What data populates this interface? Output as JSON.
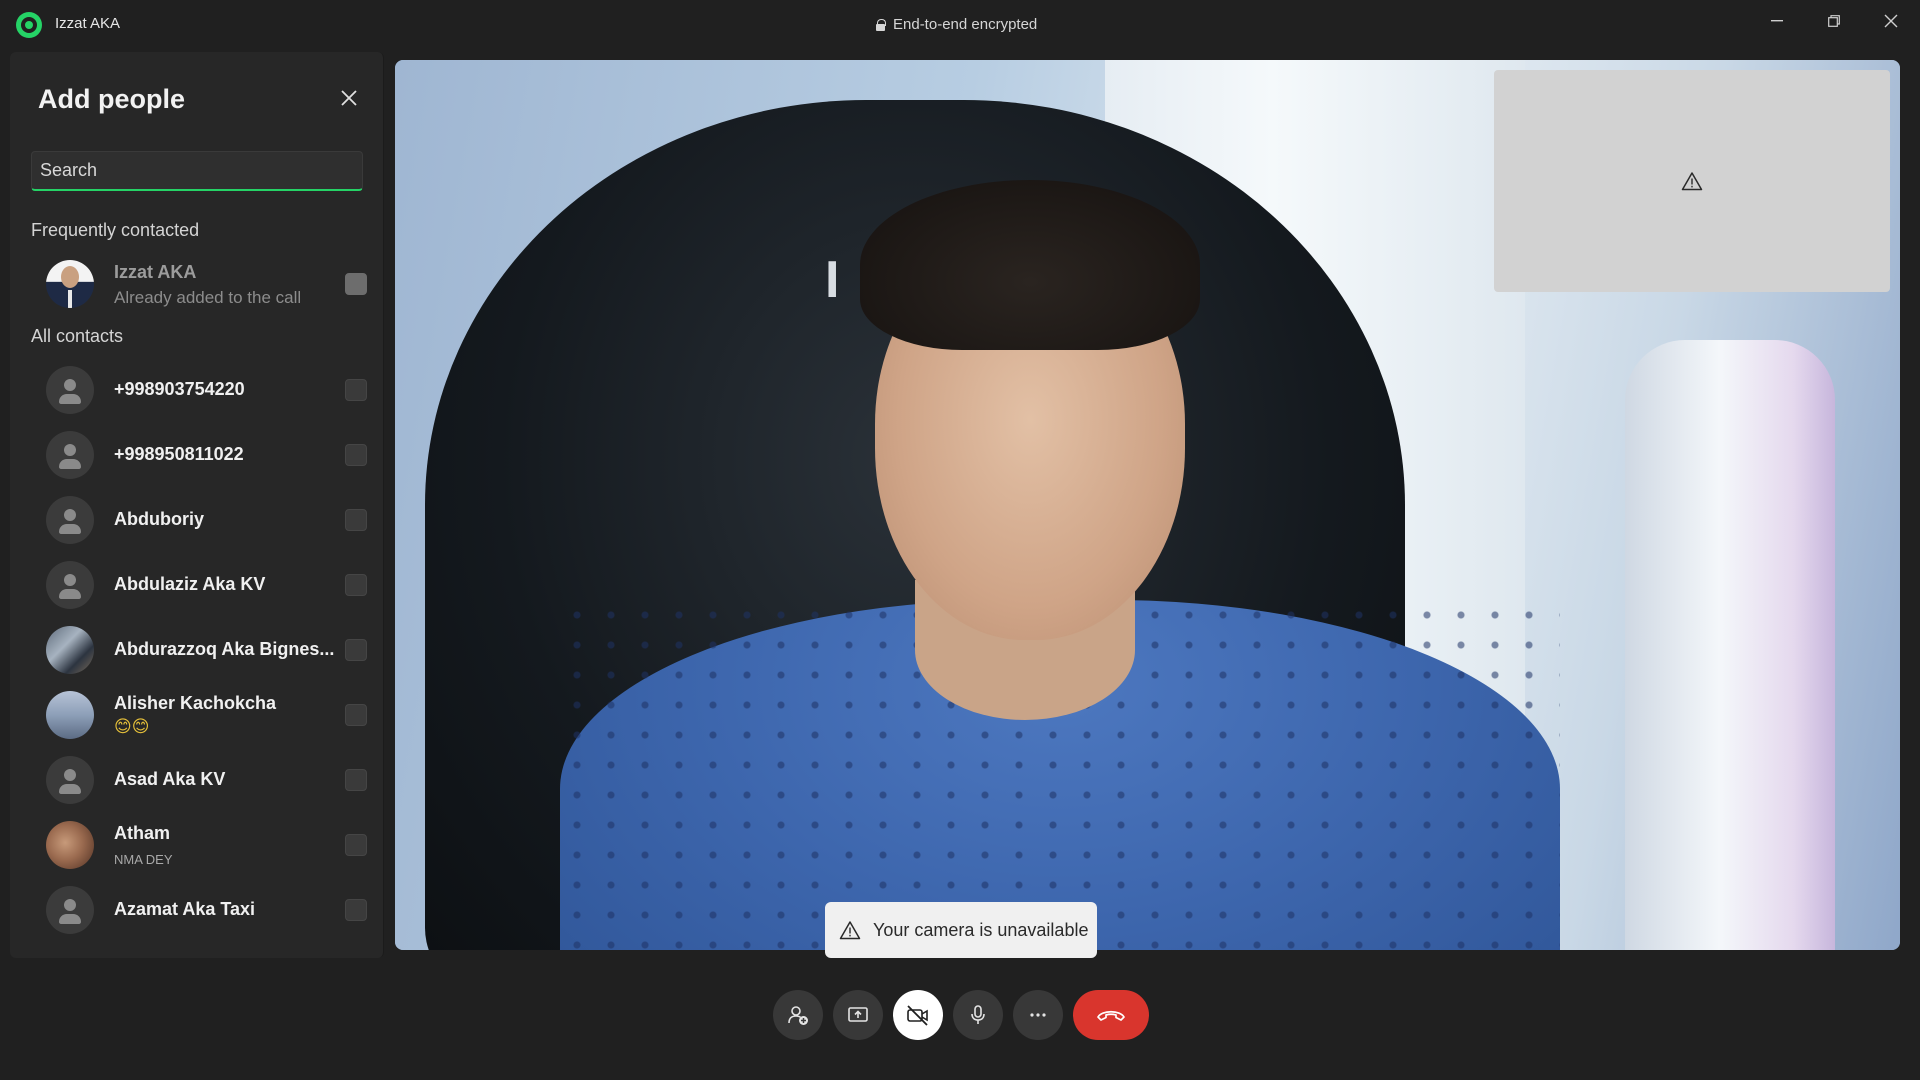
{
  "window": {
    "title": "Izzat AKA",
    "encryption_label": "End-to-end encrypted",
    "controls": [
      "minimize",
      "restore",
      "close"
    ]
  },
  "add_people": {
    "title": "Add people",
    "search_placeholder": "Search",
    "frequently_label": "Frequently contacted",
    "frequent": [
      {
        "name": "Izzat AKA",
        "subtitle": "Already added to the call",
        "checked_disabled": true
      }
    ],
    "all_label": "All contacts",
    "contacts": [
      {
        "name": "+998903754220",
        "subtitle": ""
      },
      {
        "name": "+998950811022",
        "subtitle": ""
      },
      {
        "name": "Abduboriy",
        "subtitle": ""
      },
      {
        "name": "Abdulaziz Aka KV",
        "subtitle": ""
      },
      {
        "name": "Abdurazzoq Aka Bignes...",
        "subtitle": ""
      },
      {
        "name": "Alisher Kachokcha",
        "subtitle": "😊😊"
      },
      {
        "name": "Asad Aka KV",
        "subtitle": ""
      },
      {
        "name": "Atham",
        "subtitle": "NMA DEY"
      },
      {
        "name": "Azamat Aka Taxi",
        "subtitle": ""
      }
    ]
  },
  "video": {
    "chair_logo_text": "I M",
    "camera_toast": "Your camera is unavailable"
  },
  "call_controls": {
    "add_participant": "add-participant",
    "share_screen": "share-screen",
    "camera": "camera-off",
    "microphone": "microphone",
    "more": "more-options",
    "end_call": "end-call"
  },
  "colors": {
    "accent": "#25d366",
    "end_call": "#d9352d",
    "background": "#202020",
    "panel": "#272727"
  }
}
